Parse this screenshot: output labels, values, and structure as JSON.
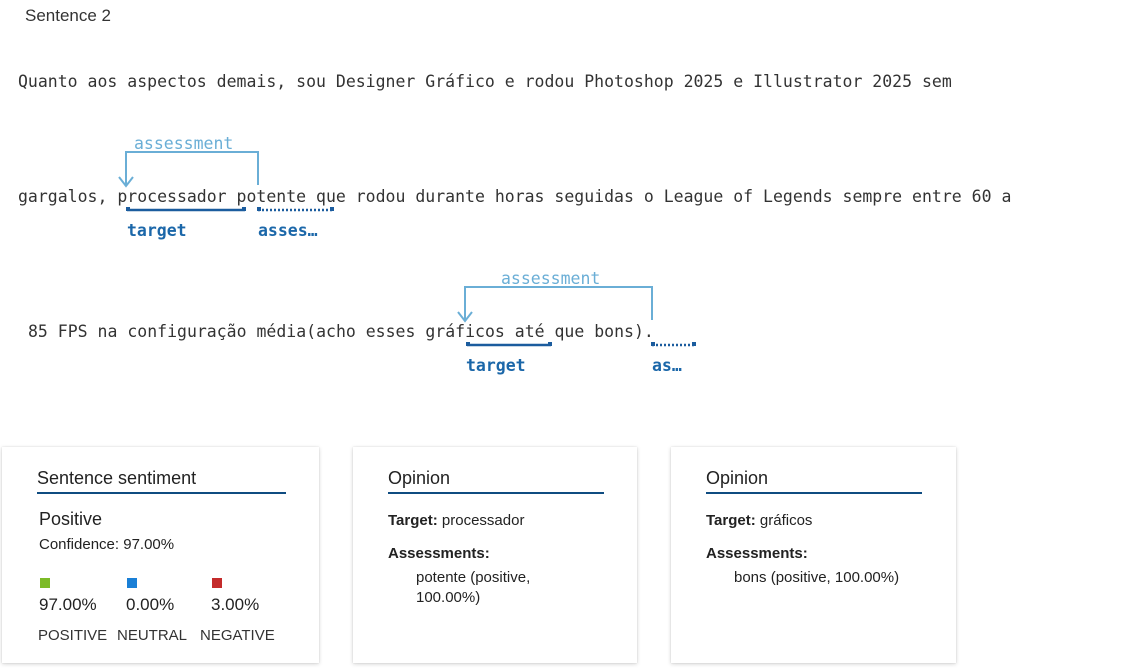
{
  "header": {
    "title": "Sentence 2"
  },
  "sentence": {
    "line1": "Quanto aos aspectos demais, sou Designer Gráfico e rodou Photoshop 2025 e Illustrator 2025 sem",
    "line2": "gargalos, processador potente que rodou durante horas seguidas o League of Legends sempre entre 60 a",
    "line3": "85 FPS na configuração média(acho esses gráficos até que bons)."
  },
  "annotations": {
    "relation_label": "assessment",
    "target_label": "target",
    "assessment_short_1": "asses…",
    "assessment_short_2": "as…"
  },
  "sentiment_card": {
    "heading": "Sentence sentiment",
    "label": "Positive",
    "confidence": "Confidence: 97.00%",
    "scores": [
      {
        "name": "POSITIVE",
        "value": "97.00%",
        "color": "#7cbb27"
      },
      {
        "name": "NEUTRAL",
        "value": "0.00%",
        "color": "#1a7fd6"
      },
      {
        "name": "NEGATIVE",
        "value": "3.00%",
        "color": "#c42b2b"
      }
    ]
  },
  "opinions": [
    {
      "heading": "Opinion",
      "target_key": "Target:",
      "target_value": "processador",
      "assessments_key": "Assessments:",
      "assessment_line1": "potente (positive,",
      "assessment_line2": "100.00%)"
    },
    {
      "heading": "Opinion",
      "target_key": "Target:",
      "target_value": "gráficos",
      "assessments_key": "Assessments:",
      "assessment_line1": "bons (positive, 100.00%)",
      "assessment_line2": ""
    }
  ],
  "colors": {
    "target_underline": "#1b5c9e",
    "arc": "#6aaed6",
    "heading_rule": "#0f4c81"
  }
}
